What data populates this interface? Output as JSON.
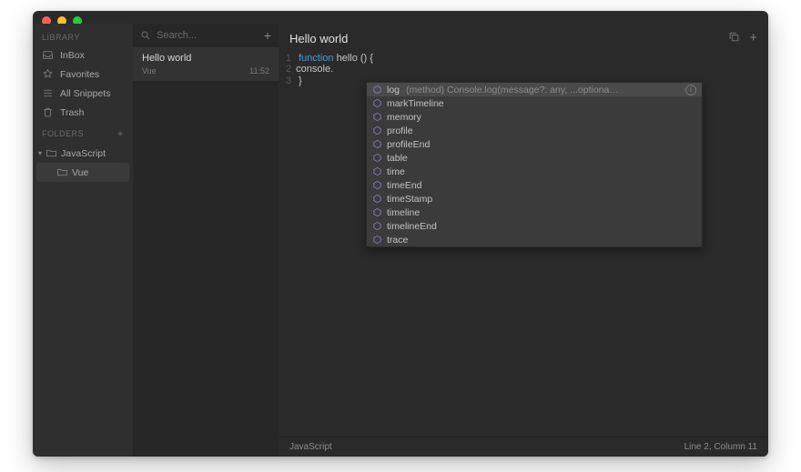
{
  "sidebar": {
    "library_label": "Library",
    "folders_label": "Folders",
    "items": [
      {
        "label": "InBox"
      },
      {
        "label": "Favorites"
      },
      {
        "label": "All Snippets"
      },
      {
        "label": "Trash"
      }
    ],
    "folders": {
      "root": "JavaScript",
      "child": "Vue"
    }
  },
  "list": {
    "search_placeholder": "Search...",
    "snippet_title": "Hello world",
    "snippet_folder": "Vue",
    "snippet_time": "11:52"
  },
  "editor": {
    "title": "Hello world",
    "lines": {
      "l1a": "function",
      "l1b": " hello () {",
      "l2": "  console.",
      "l3": "}"
    },
    "gutter": {
      "g1": "1",
      "g2": "2",
      "g3": "3"
    },
    "language": "JavaScript",
    "cursor": "Line 2, Column 11"
  },
  "autocomplete": {
    "selected_detail": "(method) Console.log(message?: any, ...optiona…",
    "items": [
      "log",
      "markTimeline",
      "memory",
      "profile",
      "profileEnd",
      "table",
      "time",
      "timeEnd",
      "timeStamp",
      "timeline",
      "timelineEnd",
      "trace"
    ]
  }
}
